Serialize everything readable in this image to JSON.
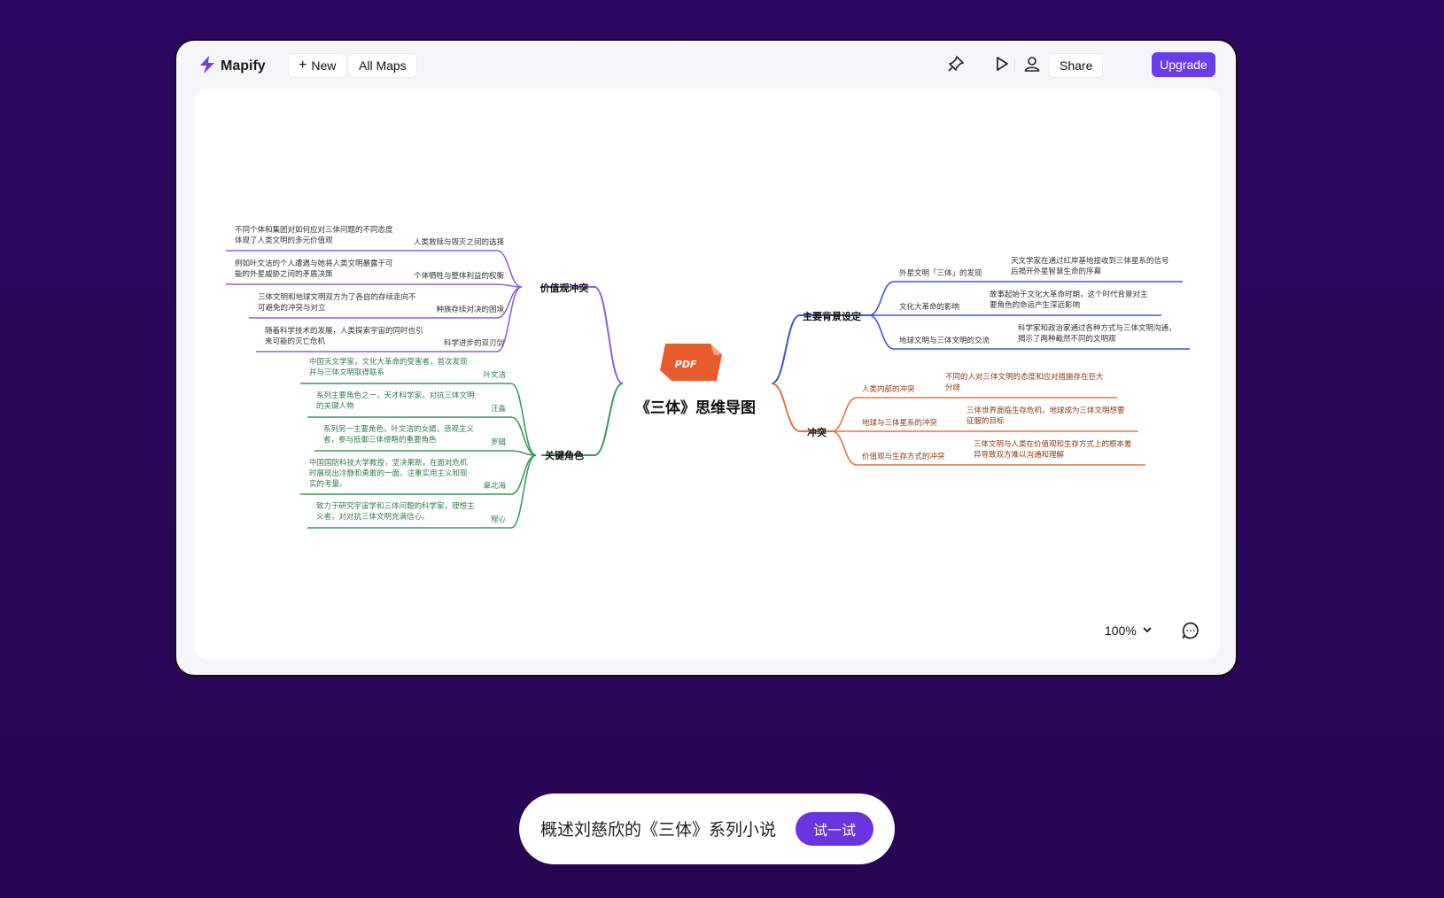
{
  "app": {
    "name": "Mapify"
  },
  "toolbar": {
    "new_label": "New",
    "all_maps_label": "All Maps",
    "share_label": "Share",
    "upgrade_label": "Upgrade"
  },
  "colors": {
    "background": "#2a0658",
    "accent": "#6b3de8",
    "branch_purple": "#8a63d2",
    "branch_green": "#3c9a5f",
    "branch_blue": "#3a55d8",
    "branch_orange": "#e2763d"
  },
  "mindmap": {
    "center": {
      "title": "《三体》思维导图",
      "badge": "PDF"
    },
    "branches": {
      "values": {
        "label": "价值观冲突",
        "items": [
          {
            "title": "人类救赎与毁灭之间的选择",
            "desc": [
              "不同个体和集团对如何应对三体问题的不同态度",
              "体现了人类文明的多元价值观"
            ]
          },
          {
            "title": "个体牺牲与整体利益的权衡",
            "desc": [
              "例如叶文洁的个人遭遇与她将人类文明暴露于可",
              "能的外星威胁之间的矛盾决策"
            ]
          },
          {
            "title": "种族存续对决的困境",
            "desc": [
              "三体文明和地球文明双方为了各自的存续走向不",
              "可避免的冲突与对立"
            ]
          },
          {
            "title": "科学进步的双刃剑",
            "desc": [
              "随着科学技术的发展，人类探索宇宙的同时也引",
              "来可能的灭亡危机"
            ]
          }
        ]
      },
      "characters": {
        "label": "关键角色",
        "items": [
          {
            "title": "叶文洁",
            "desc": [
              "中国天文学家，文化大革命的受害者，首次发现",
              "并与三体文明取得联系"
            ]
          },
          {
            "title": "汪淼",
            "desc": [
              "系列主要角色之一，天才科学家，对抗三体文明",
              "的关键人物"
            ]
          },
          {
            "title": "罗辑",
            "desc": [
              "系列另一主要角色，叶文洁的女婿，悲观主义",
              "者，参与抵御三体侵略的重要角色"
            ]
          },
          {
            "title": "章北海",
            "desc": [
              "中国国防科技大学教授，坚决果断，在面对危机",
              "时展现出冷静和勇敢的一面，注重实用主义和现",
              "实的考量。"
            ]
          },
          {
            "title": "程心",
            "desc": [
              "致力于研究宇宙学和三体问题的科学家，理想主",
              "义者，对对抗三体文明充满信心。"
            ]
          }
        ]
      },
      "background": {
        "label": "主要背景设定",
        "items": [
          {
            "title": "外星文明「三体」的发现",
            "desc": [
              "天文学家在通过红岸基地接收到三体星系的信号",
              "后揭开外星智慧生命的序幕"
            ]
          },
          {
            "title": "文化大革命的影响",
            "desc": [
              "故事起始于文化大革命时期，这个时代背景对主",
              "要角色的命运产生深远影响"
            ]
          },
          {
            "title": "地球文明与三体文明的交流",
            "desc": [
              "科学家和政治家通过各种方式与三体文明沟通，",
              "揭示了两种截然不同的文明观"
            ]
          }
        ]
      },
      "conflict": {
        "label": "冲突",
        "items": [
          {
            "title": "人类内部的冲突",
            "desc": [
              "不同的人对三体文明的态度和应对措施存在巨大",
              "分歧"
            ]
          },
          {
            "title": "地球与三体星系的冲突",
            "desc": [
              "三体世界面临生存危机，地球成为三体文明想要",
              "征服的目标"
            ]
          },
          {
            "title": "价值观与生存方式的冲突",
            "desc": [
              "三体文明与人类在价值观和生存方式上的根本差",
              "异导致双方难以沟通和理解"
            ]
          }
        ]
      }
    }
  },
  "zoom": {
    "level": "100%"
  },
  "prompt": {
    "text": "概述刘慈欣的《三体》系列小说",
    "button": "试一试"
  }
}
